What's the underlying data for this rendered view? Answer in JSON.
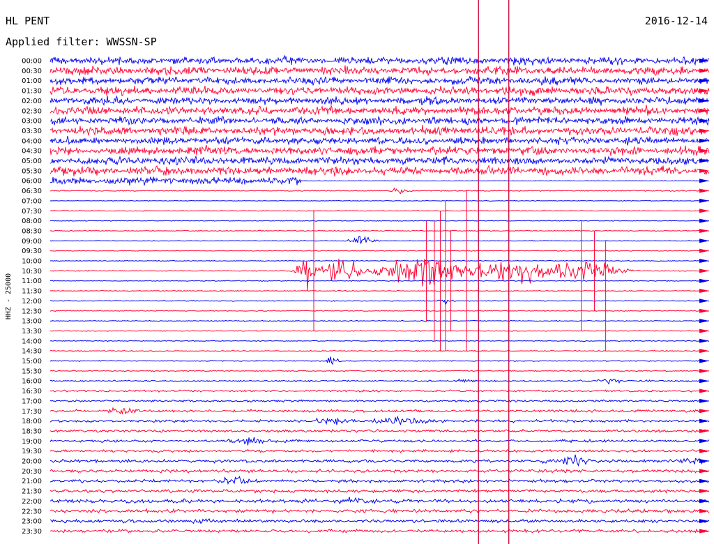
{
  "header": {
    "station": "HL PENT",
    "date": "2016-12-14",
    "filter_label": "Applied filter: WWSSN-SP"
  },
  "chart_data": {
    "type": "line",
    "title": "HL PENT",
    "date": "2016-12-14",
    "filter": "WWSSN-SP",
    "ylabel": "HHZ - 25000",
    "colors": {
      "blue": "#0000ee",
      "red": "#ff0033",
      "marker": "#cc0033"
    },
    "line_times": [
      "00:00",
      "00:30",
      "01:00",
      "01:30",
      "02:00",
      "02:30",
      "03:00",
      "03:30",
      "04:00",
      "04:30",
      "05:00",
      "05:30",
      "06:00",
      "06:30",
      "07:00",
      "07:30",
      "08:00",
      "08:30",
      "09:00",
      "09:30",
      "10:00",
      "10:30",
      "11:00",
      "11:30",
      "12:00",
      "12:30",
      "13:00",
      "13:30",
      "14:00",
      "14:30",
      "15:00",
      "15:30",
      "16:00",
      "16:30",
      "17:00",
      "17:30",
      "18:00",
      "18:30",
      "19:00",
      "19:30",
      "20:00",
      "20:30",
      "21:00",
      "21:30",
      "22:00",
      "22:30",
      "23:00",
      "23:30"
    ],
    "line_colors": [
      "blue",
      "red",
      "blue",
      "red",
      "blue",
      "red",
      "blue",
      "red",
      "blue",
      "red",
      "blue",
      "red",
      "blue",
      "red",
      "blue",
      "red",
      "blue",
      "red",
      "blue",
      "red",
      "blue",
      "red",
      "blue",
      "red",
      "blue",
      "red",
      "blue",
      "red",
      "blue",
      "red",
      "blue",
      "red",
      "blue",
      "red",
      "blue",
      "red",
      "blue",
      "red",
      "blue",
      "red",
      "blue",
      "red",
      "blue",
      "red",
      "blue",
      "red",
      "blue",
      "red"
    ],
    "noise_level": [
      8,
      9,
      8,
      9,
      8,
      9,
      8,
      9,
      8,
      9,
      8,
      9,
      8,
      1,
      0.6,
      0.7,
      0.8,
      0.8,
      0.7,
      0.7,
      0.8,
      0.9,
      0.8,
      0.8,
      0.9,
      0.8,
      0.9,
      0.9,
      0.9,
      0.9,
      1,
      1,
      1.5,
      2,
      2,
      2.5,
      2.5,
      2.5,
      2.5,
      2.5,
      3,
      3,
      3,
      3,
      3.5,
      3.5,
      3,
      3
    ],
    "noise_until_fraction": [
      1,
      1,
      1,
      1,
      1,
      1,
      1,
      1,
      1,
      1,
      1,
      1,
      0.38,
      1,
      1,
      1,
      1,
      1,
      1,
      1,
      1,
      1,
      1,
      1,
      1,
      1,
      1,
      1,
      1,
      1,
      1,
      1,
      1,
      1,
      1,
      1,
      1,
      1,
      1,
      1,
      1,
      1,
      1,
      1,
      1,
      1,
      1,
      1
    ],
    "events": [
      {
        "line": 13,
        "x_fraction": 0.53,
        "amp": 8,
        "width_fraction": 0.02
      },
      {
        "line": 18,
        "x_fraction": 0.47,
        "amp": 9,
        "width_fraction": 0.03
      },
      {
        "line": 21,
        "x_fraction": 0.39,
        "amp": 35,
        "width_fraction": 0.02
      },
      {
        "line": 21,
        "x_fraction": 0.44,
        "amp": 24,
        "width_fraction": 0.05
      },
      {
        "line": 21,
        "x_fraction": 0.53,
        "amp": 26,
        "width_fraction": 0.02
      },
      {
        "line": 21,
        "x_fraction": 0.57,
        "amp": 30,
        "width_fraction": 0.09
      },
      {
        "line": 21,
        "x_fraction": 0.7,
        "amp": 24,
        "width_fraction": 0.1
      },
      {
        "line": 21,
        "x_fraction": 0.81,
        "amp": 22,
        "width_fraction": 0.07
      },
      {
        "line": 24,
        "x_fraction": 0.6,
        "amp": 6,
        "width_fraction": 0.02
      },
      {
        "line": 30,
        "x_fraction": 0.43,
        "amp": 10,
        "width_fraction": 0.015
      },
      {
        "line": 32,
        "x_fraction": 0.63,
        "amp": 5,
        "width_fraction": 0.03
      },
      {
        "line": 32,
        "x_fraction": 0.85,
        "amp": 5,
        "width_fraction": 0.03
      },
      {
        "line": 35,
        "x_fraction": 0.11,
        "amp": 9,
        "width_fraction": 0.03
      },
      {
        "line": 36,
        "x_fraction": 0.43,
        "amp": 8,
        "width_fraction": 0.05
      },
      {
        "line": 36,
        "x_fraction": 0.53,
        "amp": 7,
        "width_fraction": 0.08
      },
      {
        "line": 38,
        "x_fraction": 0.3,
        "amp": 8,
        "width_fraction": 0.06
      },
      {
        "line": 40,
        "x_fraction": 0.79,
        "amp": 11,
        "width_fraction": 0.06
      },
      {
        "line": 40,
        "x_fraction": 0.97,
        "amp": 8,
        "width_fraction": 0.04
      },
      {
        "line": 42,
        "x_fraction": 0.28,
        "amp": 9,
        "width_fraction": 0.04
      },
      {
        "line": 44,
        "x_fraction": 0.46,
        "amp": 8,
        "width_fraction": 0.05
      },
      {
        "line": 46,
        "x_fraction": 0.23,
        "amp": 7,
        "width_fraction": 0.05
      }
    ],
    "spikes": [
      {
        "x_fraction": 0.4,
        "line": 21,
        "up": 6,
        "down": 6
      },
      {
        "x_fraction": 0.571,
        "line": 20,
        "up": 4,
        "down": 6
      },
      {
        "x_fraction": 0.583,
        "line": 20,
        "up": 4,
        "down": 8
      },
      {
        "x_fraction": 0.592,
        "line": 20,
        "up": 5,
        "down": 9
      },
      {
        "x_fraction": 0.6,
        "line": 20,
        "up": 6,
        "down": 9
      },
      {
        "x_fraction": 0.608,
        "line": 20,
        "up": 3,
        "down": 7
      },
      {
        "x_fraction": 0.632,
        "line": 21,
        "up": 8,
        "down": 8
      },
      {
        "x_fraction": 0.806,
        "line": 21,
        "up": 5,
        "down": 6
      },
      {
        "x_fraction": 0.826,
        "line": 21,
        "up": 4,
        "down": 4
      },
      {
        "x_fraction": 0.843,
        "line": 21,
        "up": 3,
        "down": 8
      }
    ],
    "markers_x_fraction": [
      0.65,
      0.696
    ]
  }
}
